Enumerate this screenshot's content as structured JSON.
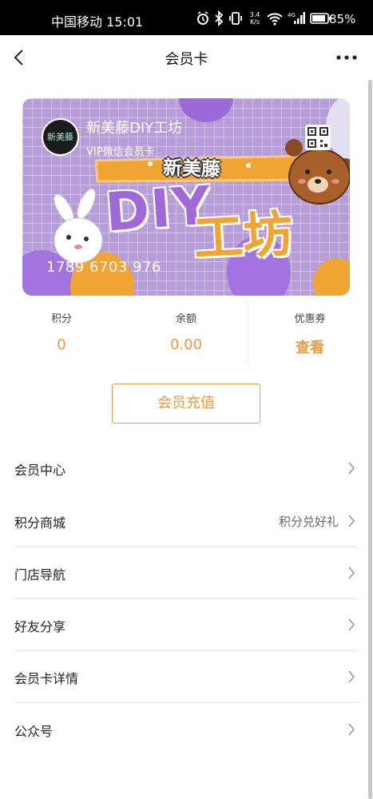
{
  "status_bar": {
    "carrier": "中国移动 15:01",
    "speed_value": "3.4",
    "speed_unit": "K/s",
    "battery": "85%"
  },
  "nav": {
    "title": "会员卡",
    "back_icon": "chevron-left-icon",
    "more_icon": "more-horizontal-icon"
  },
  "card": {
    "logo_text": "新美藤",
    "name": "新美藤DIY工坊",
    "subtitle": "VIP微信会员卡",
    "number": "1789 6703 976",
    "banner_text": "新美藤",
    "diy_text": "DIY",
    "workshop_text": "工坊",
    "qr_icon": "qr-code-icon"
  },
  "stats": {
    "points_label": "积分",
    "points_value": "0",
    "balance_label": "余额",
    "balance_value": "0.00",
    "coupon_label": "优惠券",
    "coupon_value": "查看"
  },
  "recharge_label": "会员充值",
  "menu": [
    {
      "label": "会员中心",
      "value": ""
    },
    {
      "label": "积分商城",
      "value": "积分兑好礼"
    },
    {
      "label": "门店导航",
      "value": ""
    },
    {
      "label": "好友分享",
      "value": ""
    },
    {
      "label": "会员卡详情",
      "value": ""
    },
    {
      "label": "公众号",
      "value": ""
    }
  ],
  "colors": {
    "accent": "#e69a43",
    "card_bg": "#b79dd8",
    "status_bar_bg": "#000000"
  }
}
